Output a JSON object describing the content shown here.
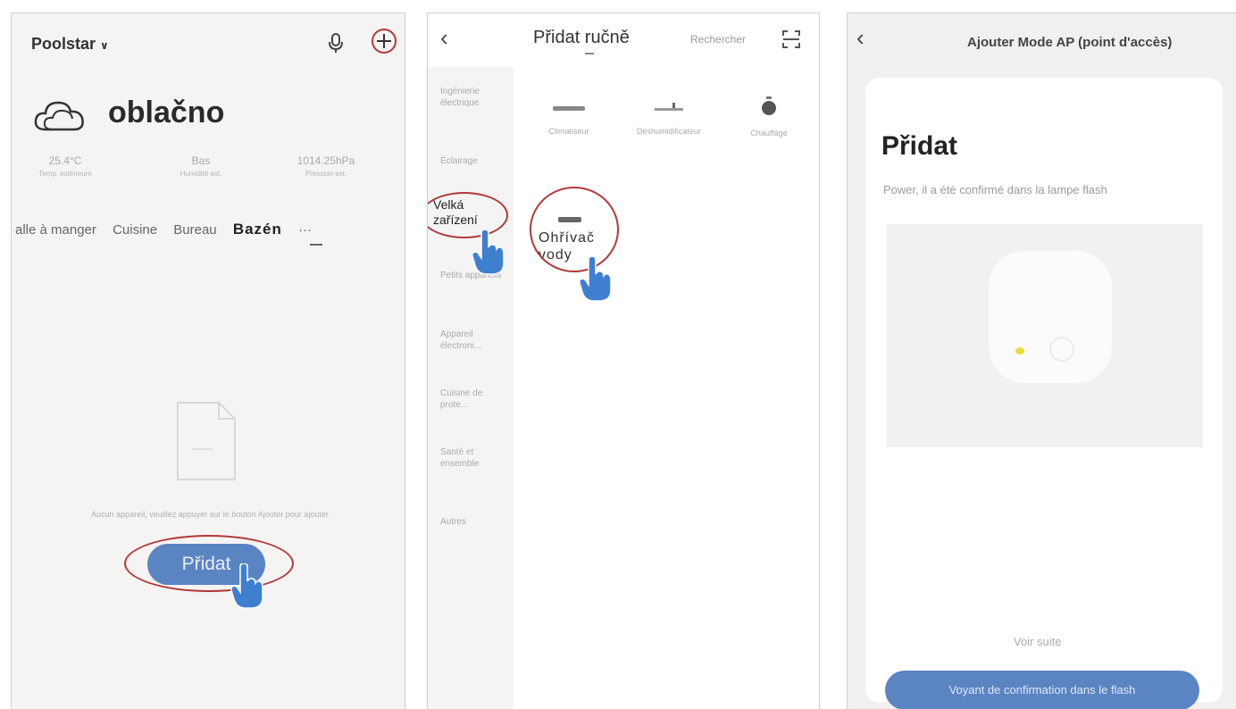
{
  "panel1": {
    "home_title": "Poolstar",
    "weather": "oblačno",
    "stats": [
      {
        "value": "25.4°C",
        "label": "Temp. extérieure"
      },
      {
        "value": "Bas",
        "label": "Humidité ext."
      },
      {
        "value": "1014.25hPa",
        "label": "Pression ext."
      }
    ],
    "tabs": [
      "alle à manger",
      "Cuisine",
      "Bureau",
      "Bazén",
      "···"
    ],
    "empty_message": "Aucun appareil, veuillez appuyer sur le bouton Ajouter pour ajouter",
    "add_button": "Přidat"
  },
  "panel2": {
    "title": "Přidat ručně",
    "search": "Rechercher",
    "sidebar": [
      "Ingénierie électrique",
      "Éclairage",
      "Velká zařízení",
      "Petits appareils",
      "Appareil électroni...",
      "Cuisine de prote...",
      "Santé et ensemble",
      "Autres"
    ],
    "devices": [
      "Climatiseur",
      "Déshumidificateur",
      "Chauffage"
    ],
    "heater": "Ohřívač vody"
  },
  "panel3": {
    "title": "Ajouter  Mode AP (point d'accès)",
    "card_title": "Přidat",
    "card_sub": "Power, il a été confirmé dans la lampe flash",
    "voir": "Voir suite",
    "confirm_button": "Voyant de confirmation dans le flash"
  },
  "colors": {
    "accent": "#5b84c3",
    "annotation": "#b13a3a",
    "hand": "#3f7fd0"
  }
}
